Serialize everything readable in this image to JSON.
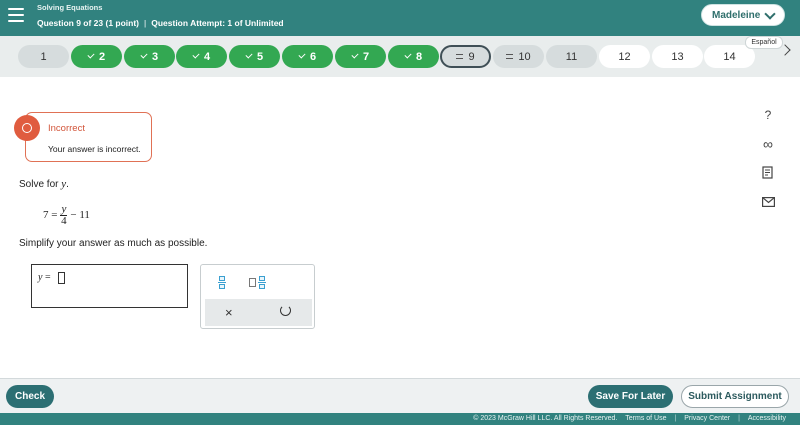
{
  "header": {
    "title": "Solving Equations",
    "question_info": "Question 9 of 23 (1 point)",
    "attempt_info": "Question Attempt: 1 of Unlimited",
    "separator": "|",
    "user_name": "Madeleine"
  },
  "questions": [
    {
      "label": "1",
      "state": "plain"
    },
    {
      "label": "2",
      "state": "done"
    },
    {
      "label": "3",
      "state": "done"
    },
    {
      "label": "4",
      "state": "done"
    },
    {
      "label": "5",
      "state": "done"
    },
    {
      "label": "6",
      "state": "done"
    },
    {
      "label": "7",
      "state": "done"
    },
    {
      "label": "8",
      "state": "done"
    },
    {
      "label": "9",
      "state": "current"
    },
    {
      "label": "10",
      "state": "partial"
    },
    {
      "label": "11",
      "state": "plain"
    },
    {
      "label": "12",
      "state": "white"
    },
    {
      "label": "13",
      "state": "white"
    },
    {
      "label": "14",
      "state": "white"
    }
  ],
  "espanol_label": "Español",
  "feedback": {
    "title": "Incorrect",
    "message": "Your answer is incorrect."
  },
  "problem": {
    "prompt": "Solve for",
    "variable": "y",
    "period": ".",
    "eq_left": "7 =",
    "eq_num": "y",
    "eq_den": "4",
    "eq_right": "− 11",
    "instruction": "Simplify your answer as much as possible."
  },
  "answer": {
    "var": "y",
    "eq": "="
  },
  "palette": {
    "clear_symbol": "×"
  },
  "side_tools": {
    "help": "?",
    "infinity": "∞"
  },
  "footer": {
    "check": "Check",
    "save_later": "Save For Later",
    "submit": "Submit Assignment"
  },
  "legal": {
    "copyright": "© 2023 McGraw Hill LLC. All Rights Reserved.",
    "terms": "Terms of Use",
    "privacy": "Privacy Center",
    "accessibility": "Accessibility",
    "pipe": "|"
  },
  "colors": {
    "header_teal": "#31827f",
    "done_green": "#33a852",
    "incorrect_red": "#e05c3f",
    "button_teal": "#2c6f73"
  }
}
